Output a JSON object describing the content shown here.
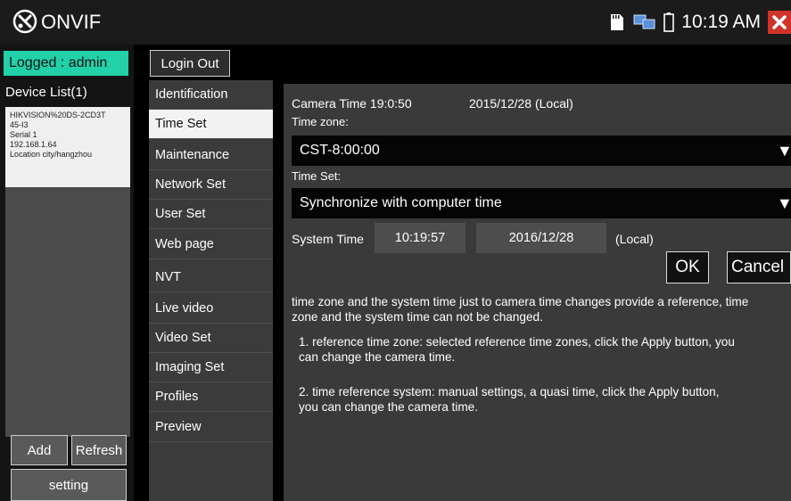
{
  "titlebar": {
    "app_title": "ONVIF",
    "clock": "10:19 AM"
  },
  "left": {
    "logged": "Logged : admin",
    "device_list_title": "Device List(1)",
    "device": {
      "name_line1": "HIKVISION%20DS-2CD3T",
      "name_line2": "45-I3",
      "serial": "Serial 1",
      "ip": "192.168.1.64",
      "location": "Location city/hangzhou"
    },
    "add_label": "Add",
    "refresh_label": "Refresh",
    "setting_label": "setting"
  },
  "login_out_label": "Login Out",
  "menu": {
    "items": [
      "Identification",
      "Time Set",
      "Maintenance",
      "Network Set",
      "User Set",
      "Web page",
      "NVT",
      "Live video",
      "Video Set",
      "Imaging Set",
      "Profiles",
      "Preview"
    ],
    "active": "Time Set"
  },
  "main": {
    "camera_time_label": "Camera Time 19:0:50",
    "camera_date": "2015/12/28 (Local)",
    "timezone_label": "Time zone:",
    "timezone_value": "CST-8:00:00",
    "timeset_label": "Time Set:",
    "timeset_value": "Synchronize with computer time",
    "system_time_label": "System Time",
    "system_time_value": "10:19:57",
    "system_date_value": "2016/12/28",
    "local_label": "(Local)",
    "ok_label": "OK",
    "cancel_label": "Cancel",
    "desc_line1": "time zone and the system time just to camera time changes provide a reference, time",
    "desc_line2": "zone and the system time can not be changed.",
    "note1_line1": "1. reference time zone: selected reference time zones, click the Apply button, you",
    "note1_line2": "can change the camera time.",
    "note2_line1": "2. time reference system: manual settings, a quasi time, click the Apply button,",
    "note2_line2": "you can change the camera time."
  },
  "colors": {
    "accent": "#22d1a9",
    "close": "#d0332a",
    "panel": "#3a3a3a"
  }
}
